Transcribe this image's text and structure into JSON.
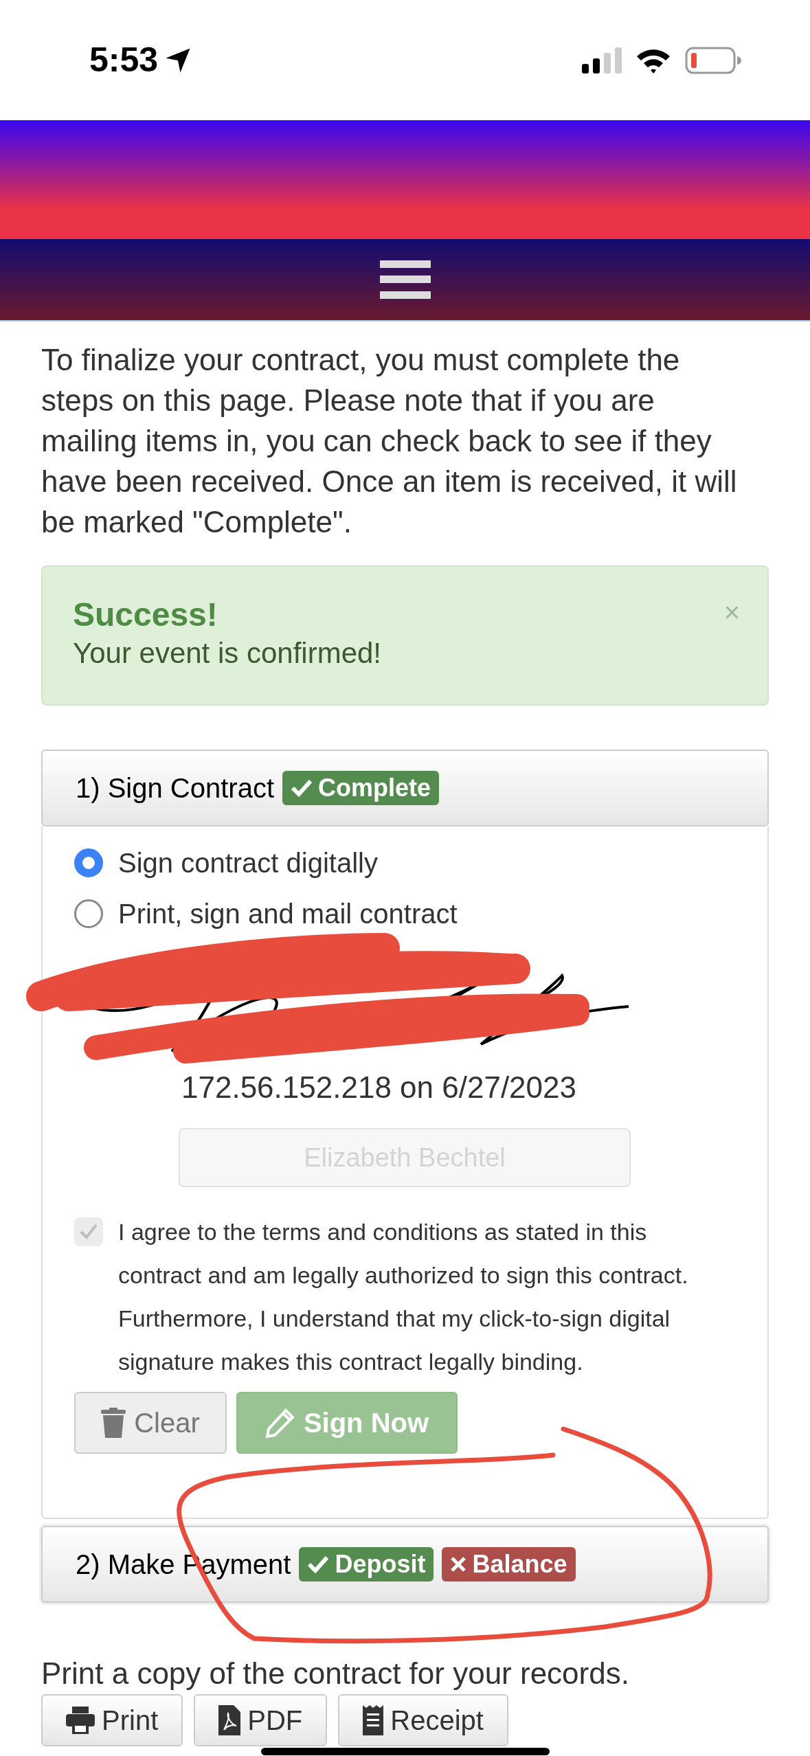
{
  "status_bar": {
    "time": "5:53"
  },
  "intro": "To finalize your contract, you must complete the steps on this page. Please note that if you are mailing items in, you can check back to see if they have been received. Once an item is received, it will be marked \"Complete\".",
  "alert": {
    "title": "Success!",
    "message": "Your event is confirmed!",
    "close": "×"
  },
  "steps": [
    {
      "title": "1) Sign Contract",
      "badges": [
        {
          "label": "Complete",
          "kind": "done",
          "color": "#548b4e"
        }
      ],
      "expanded": true
    },
    {
      "title": "2) Make Payment",
      "badges": [
        {
          "label": "Deposit",
          "kind": "done",
          "color": "#548b4e"
        },
        {
          "label": "Balance",
          "kind": "missing",
          "color": "#ad4e4b"
        }
      ],
      "expanded": false
    }
  ],
  "sign_options": [
    {
      "label": "Sign contract digitally",
      "selected": true
    },
    {
      "label": "Print, sign and mail contract",
      "selected": false
    }
  ],
  "signature_info": "172.56.152.218 on 6/27/2023",
  "name_field": {
    "value": "Elizabeth Bechtel",
    "disabled": true
  },
  "agreement": {
    "text": "I agree to the terms and conditions as stated in this contract and am legally authorized to sign this contract. Furthermore, I understand that my click-to-sign digital signature makes this contract legally binding.",
    "checked": true,
    "disabled": true
  },
  "sign_buttons": [
    {
      "label": "Clear",
      "kind": "clear",
      "disabled": false
    },
    {
      "label": "Sign Now",
      "kind": "sign",
      "disabled": true
    }
  ],
  "footer_text": "Print a copy of the contract for your records.",
  "footer_buttons": [
    {
      "label": "Print",
      "kind": "print"
    },
    {
      "label": "PDF",
      "kind": "pdf"
    },
    {
      "label": "Receipt",
      "kind": "receipt"
    }
  ]
}
